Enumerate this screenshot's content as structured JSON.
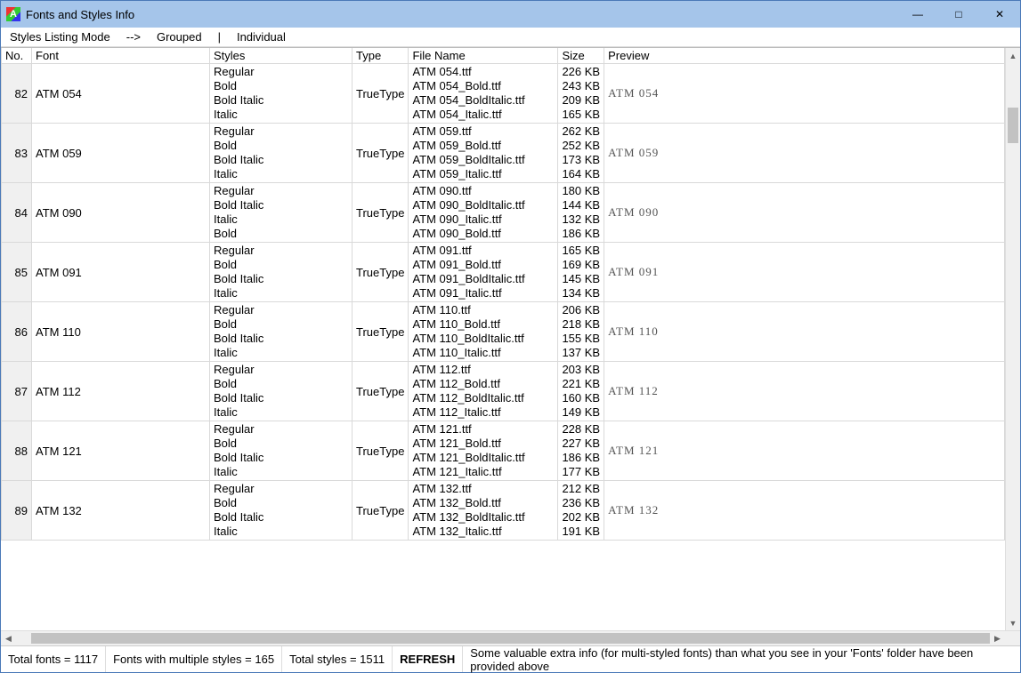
{
  "window": {
    "title": "Fonts and Styles Info"
  },
  "menu": {
    "label": "Styles Listing Mode",
    "arrow": "-->",
    "grouped": "Grouped",
    "sep": "|",
    "individual": "Individual"
  },
  "columns": {
    "no": "No.",
    "font": "Font",
    "styles": "Styles",
    "type": "Type",
    "fname": "File Name",
    "size": "Size",
    "preview": "Preview"
  },
  "rows": [
    {
      "no": 82,
      "font": "ATM 054",
      "styles": [
        "Regular",
        "Bold",
        "Bold Italic",
        "Italic"
      ],
      "type": "TrueType",
      "files": [
        "ATM 054.ttf",
        "ATM 054_Bold.ttf",
        "ATM 054_BoldItalic.ttf",
        "ATM 054_Italic.ttf"
      ],
      "sizes": [
        "226 KB",
        "243 KB",
        "209 KB",
        "165 KB"
      ],
      "preview": "ATM 054"
    },
    {
      "no": 83,
      "font": "ATM 059",
      "styles": [
        "Regular",
        "Bold",
        "Bold Italic",
        "Italic"
      ],
      "type": "TrueType",
      "files": [
        "ATM 059.ttf",
        "ATM 059_Bold.ttf",
        "ATM 059_BoldItalic.ttf",
        "ATM 059_Italic.ttf"
      ],
      "sizes": [
        "262 KB",
        "252 KB",
        "173 KB",
        "164 KB"
      ],
      "preview": "ATM 059"
    },
    {
      "no": 84,
      "font": "ATM 090",
      "styles": [
        "Regular",
        "Bold Italic",
        "Italic",
        "Bold"
      ],
      "type": "TrueType",
      "files": [
        "ATM 090.ttf",
        "ATM 090_BoldItalic.ttf",
        "ATM 090_Italic.ttf",
        "ATM 090_Bold.ttf"
      ],
      "sizes": [
        "180 KB",
        "144 KB",
        "132 KB",
        "186 KB"
      ],
      "preview": "ATM 090"
    },
    {
      "no": 85,
      "font": "ATM 091",
      "styles": [
        "Regular",
        "Bold",
        "Bold Italic",
        "Italic"
      ],
      "type": "TrueType",
      "files": [
        "ATM 091.ttf",
        "ATM 091_Bold.ttf",
        "ATM 091_BoldItalic.ttf",
        "ATM 091_Italic.ttf"
      ],
      "sizes": [
        "165 KB",
        "169 KB",
        "145 KB",
        "134 KB"
      ],
      "preview": "ATM 091"
    },
    {
      "no": 86,
      "font": "ATM 110",
      "styles": [
        "Regular",
        "Bold",
        "Bold Italic",
        "Italic"
      ],
      "type": "TrueType",
      "files": [
        "ATM 110.ttf",
        "ATM 110_Bold.ttf",
        "ATM 110_BoldItalic.ttf",
        "ATM 110_Italic.ttf"
      ],
      "sizes": [
        "206 KB",
        "218 KB",
        "155 KB",
        "137 KB"
      ],
      "preview": "ATM 110"
    },
    {
      "no": 87,
      "font": "ATM 112",
      "styles": [
        "Regular",
        "Bold",
        "Bold Italic",
        "Italic"
      ],
      "type": "TrueType",
      "files": [
        "ATM 112.ttf",
        "ATM 112_Bold.ttf",
        "ATM 112_BoldItalic.ttf",
        "ATM 112_Italic.ttf"
      ],
      "sizes": [
        "203 KB",
        "221 KB",
        "160 KB",
        "149 KB"
      ],
      "preview": "ATM 112"
    },
    {
      "no": 88,
      "font": "ATM 121",
      "styles": [
        "Regular",
        "Bold",
        "Bold Italic",
        "Italic"
      ],
      "type": "TrueType",
      "files": [
        "ATM 121.ttf",
        "ATM 121_Bold.ttf",
        "ATM 121_BoldItalic.ttf",
        "ATM 121_Italic.ttf"
      ],
      "sizes": [
        "228 KB",
        "227 KB",
        "186 KB",
        "177 KB"
      ],
      "preview": "ATM 121"
    },
    {
      "no": 89,
      "font": "ATM 132",
      "styles": [
        "Regular",
        "Bold",
        "Bold Italic",
        "Italic"
      ],
      "type": "TrueType",
      "files": [
        "ATM 132.ttf",
        "ATM 132_Bold.ttf",
        "ATM 132_BoldItalic.ttf",
        "ATM 132_Italic.ttf"
      ],
      "sizes": [
        "212 KB",
        "236 KB",
        "202 KB",
        "191 KB"
      ],
      "preview": "ATM 132"
    }
  ],
  "status": {
    "total_fonts": "Total fonts = 1117",
    "multi": "Fonts with multiple styles = 165",
    "total_styles": "Total styles = 1511",
    "refresh": "REFRESH",
    "info": "Some valuable extra info (for multi-styled fonts) than what you see in your 'Fonts' folder have been provided above"
  }
}
